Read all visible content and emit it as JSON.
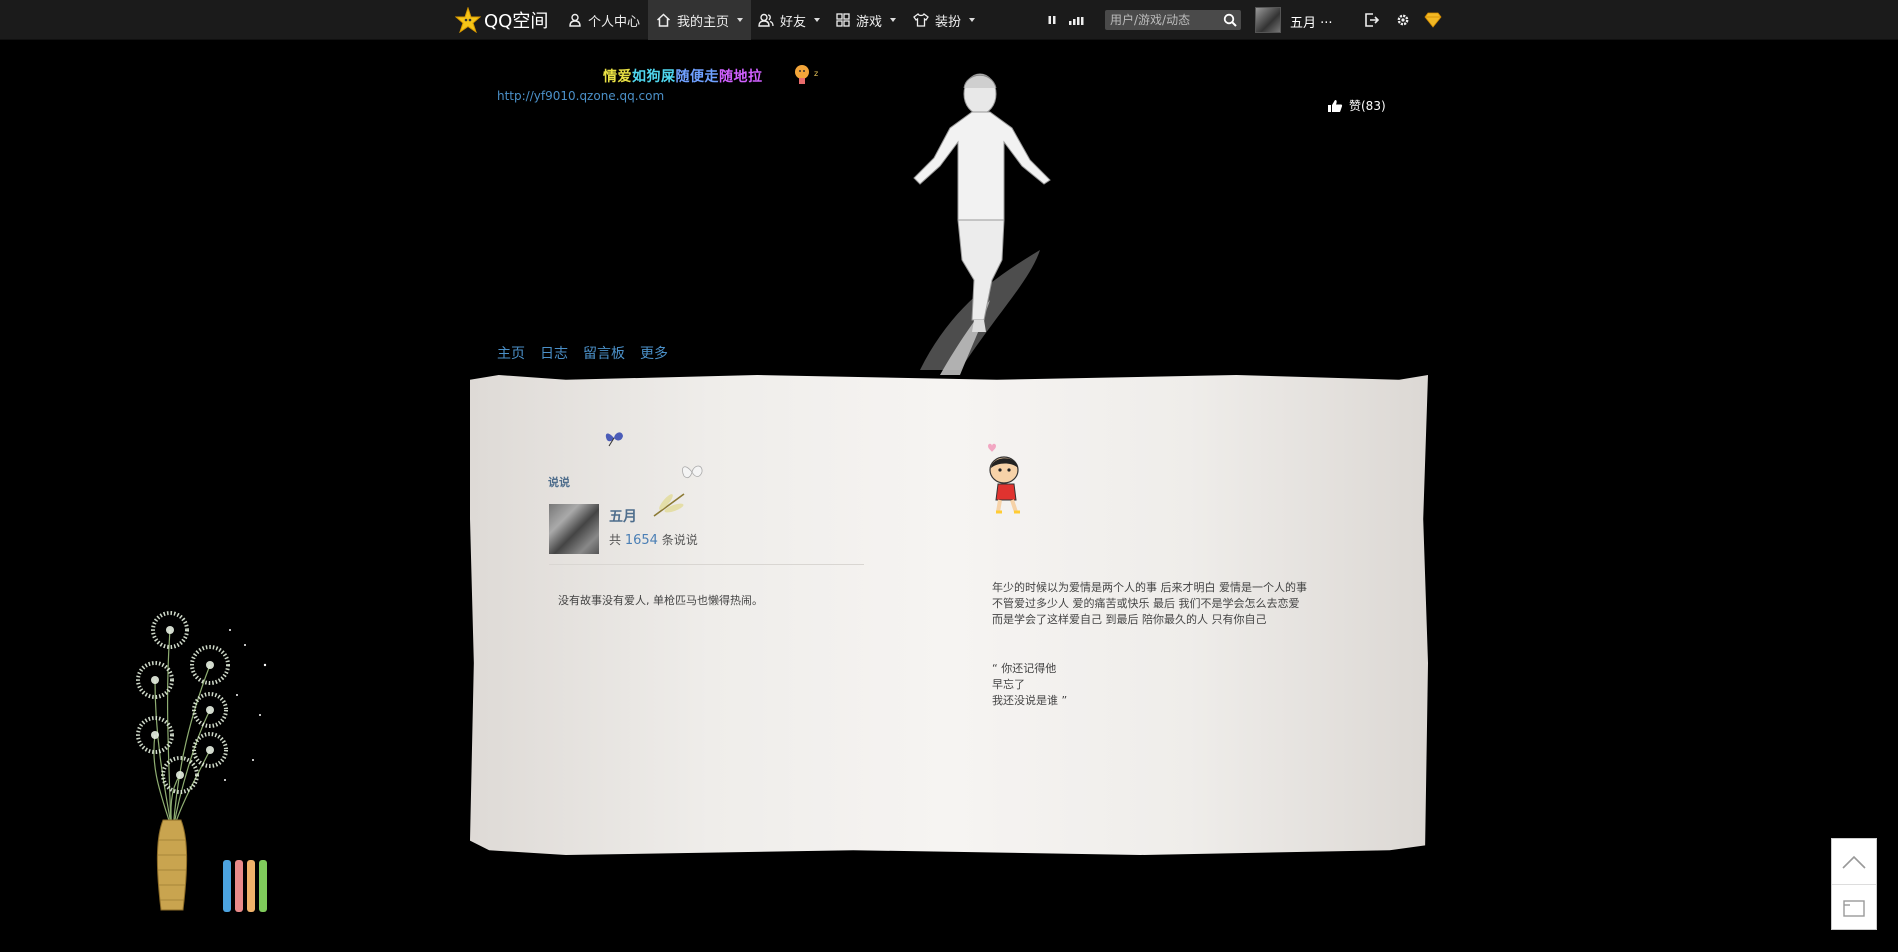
{
  "topbar": {
    "logo_text": "QQ空间",
    "nav": [
      {
        "label": "个人中心",
        "icon": "user-icon"
      },
      {
        "label": "我的主页",
        "icon": "home-icon",
        "active": true
      },
      {
        "label": "好友",
        "icon": "friends-icon"
      },
      {
        "label": "游戏",
        "icon": "grid-icon"
      },
      {
        "label": "装扮",
        "icon": "shirt-icon"
      }
    ],
    "search_placeholder": "用户/游戏/动态",
    "user_name": "五月 ···"
  },
  "header": {
    "title_parts": [
      "情爱",
      "如狗屎",
      "随便走",
      "随地拉"
    ],
    "url": "http://yf9010.qzone.qq.com",
    "like_label": "赞(83)",
    "tabs": [
      "主页",
      "日志",
      "留言板",
      "更多"
    ]
  },
  "shuoshuo": {
    "section_title": "说说",
    "author": "五月",
    "count_prefix": "共",
    "count": "1654",
    "count_suffix": "条说说",
    "latest_post": "没有故事没有爱人, 单枪匹马也懒得热闹。"
  },
  "quote": {
    "lines": [
      "年少的时候以为爱情是两个人的事 后来才明白 爱情是一个人的事",
      "不管爱过多少人 爱的痛苦或快乐 最后 我们不是学会怎么去恋爱",
      "而是学会了这样爱自己 到最后 陪你最久的人 只有你自己"
    ]
  },
  "poem": {
    "lines": [
      "“ 你还记得他",
      "早忘了",
      "我还没说是谁 ”"
    ]
  },
  "colors": {
    "link": "#4b90c8",
    "accent": "#f2b824",
    "paper": "#efedea"
  }
}
